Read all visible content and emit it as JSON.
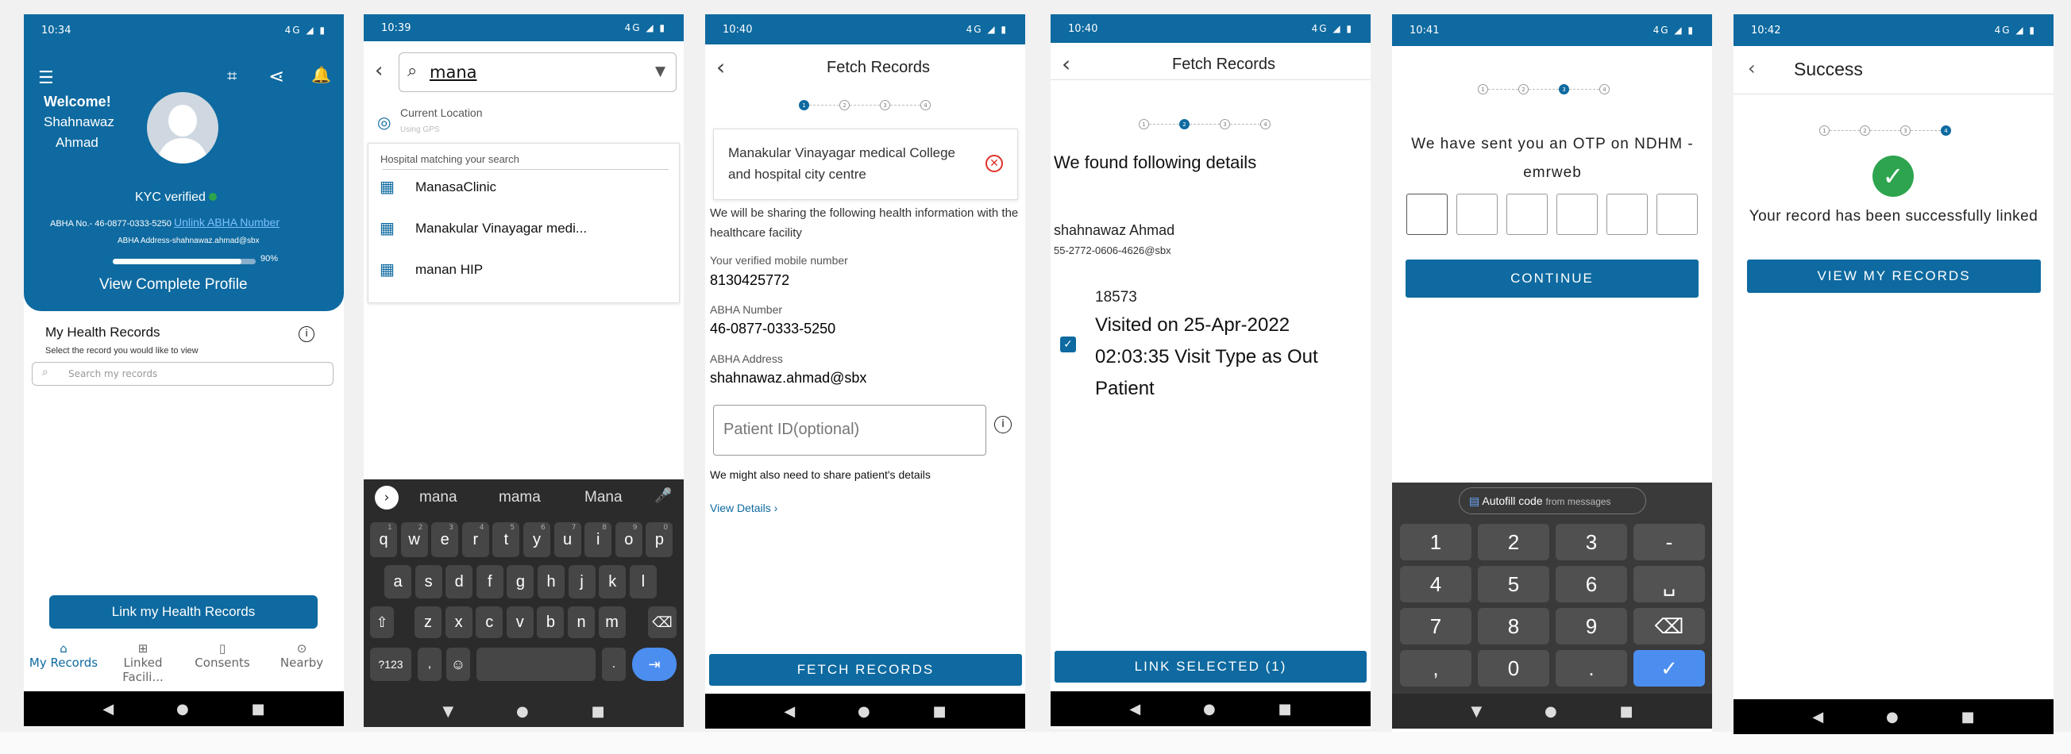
{
  "s1": {
    "time": "10:34",
    "net": "4G",
    "welcome": "Welcome!",
    "name1": "Shahnawaz",
    "name2": "Ahmad",
    "kyc": "KYC verified",
    "abha_no_label": "ABHA No.-",
    "abha_no": "46-0877-0333-5250",
    "unlink": "Unlink ABHA Number",
    "addr_label": "ABHA Address-",
    "addr": "shahnawaz.ahmad@sbx",
    "progress_label": "90%",
    "progress": 0.9,
    "view_profile": "View Complete Profile",
    "records_title": "My Health Records",
    "records_sub": "Select the record you would like to view",
    "search_ph": "Search my records",
    "link_btn": "Link my Health Records",
    "tabs": [
      "My Records",
      "Linked Facili...",
      "Consents",
      "Nearby"
    ]
  },
  "s2": {
    "time": "10:39",
    "net": "4G",
    "query": "mana",
    "current_location": "Current Location",
    "using_gps": "Using GPS",
    "section": "Hospital matching your search",
    "results": [
      "ManasaClinic",
      "Manakular Vinayagar medi...",
      "manan HIP"
    ],
    "suggestions": [
      "mana",
      "mama",
      "Mana"
    ],
    "row1": [
      "q",
      "w",
      "e",
      "r",
      "t",
      "y",
      "u",
      "i",
      "o",
      "p"
    ],
    "row1n": [
      "1",
      "2",
      "3",
      "4",
      "5",
      "6",
      "7",
      "8",
      "9",
      "0"
    ],
    "row2": [
      "a",
      "s",
      "d",
      "f",
      "g",
      "h",
      "j",
      "k",
      "l"
    ],
    "row3": [
      "z",
      "x",
      "c",
      "v",
      "b",
      "n",
      "m"
    ],
    "sym": "?123",
    "comma": ",",
    "period": "."
  },
  "s3": {
    "time": "10:40",
    "net": "4G",
    "title": "Fetch Records",
    "steps": [
      "1",
      "2",
      "3",
      "4"
    ],
    "hospital": "Manakular Vinayagar medical College and hospital city centre",
    "info": "We will be sharing the following health information with the healthcare facility",
    "mobile_label": "Your verified mobile number",
    "mobile": "8130425772",
    "abha_label": "ABHA Number",
    "abha": "46-0877-0333-5250",
    "addr_label": "ABHA Address",
    "addr": "shahnawaz.ahmad@sbx",
    "patient_ph": "Patient ID(optional)",
    "might": "We might also need to share patient's details",
    "view_details": "View Details",
    "fetch": "FETCH RECORDS"
  },
  "s4": {
    "time": "10:40",
    "net": "4G",
    "title": "Fetch Records",
    "steps": [
      "1",
      "2",
      "3",
      "4"
    ],
    "heading": "We found following details",
    "name": "shahnawaz Ahmad",
    "addr": "55-2772-0606-4626@sbx",
    "record_id": "18573",
    "record_text": "Visited on 25-Apr-2022 02:03:35 Visit Type as Out Patient",
    "link": "LINK SELECTED (1)"
  },
  "s5": {
    "time": "10:41",
    "net": "4G",
    "steps": [
      "1",
      "2",
      "3",
      "4"
    ],
    "otp_text": "We have sent you an OTP on NDHM - emrweb",
    "continue": "CONTINUE",
    "autofill": "Autofill code",
    "from_messages": "from messages",
    "keys": [
      "1",
      "2",
      "3",
      "-",
      "4",
      "5",
      "6",
      "␣",
      "7",
      "8",
      "9",
      "⌫",
      ",",
      "0",
      ".",
      "✓"
    ]
  },
  "s6": {
    "time": "10:42",
    "net": "4G",
    "title": "Success",
    "steps": [
      "1",
      "2",
      "3",
      "4"
    ],
    "msg": "Your record has been successfully linked",
    "view": "VIEW MY RECORDS"
  },
  "colors": {
    "primary": "#0e6aa0",
    "success": "#2ea44f",
    "error": "#e0312b"
  }
}
